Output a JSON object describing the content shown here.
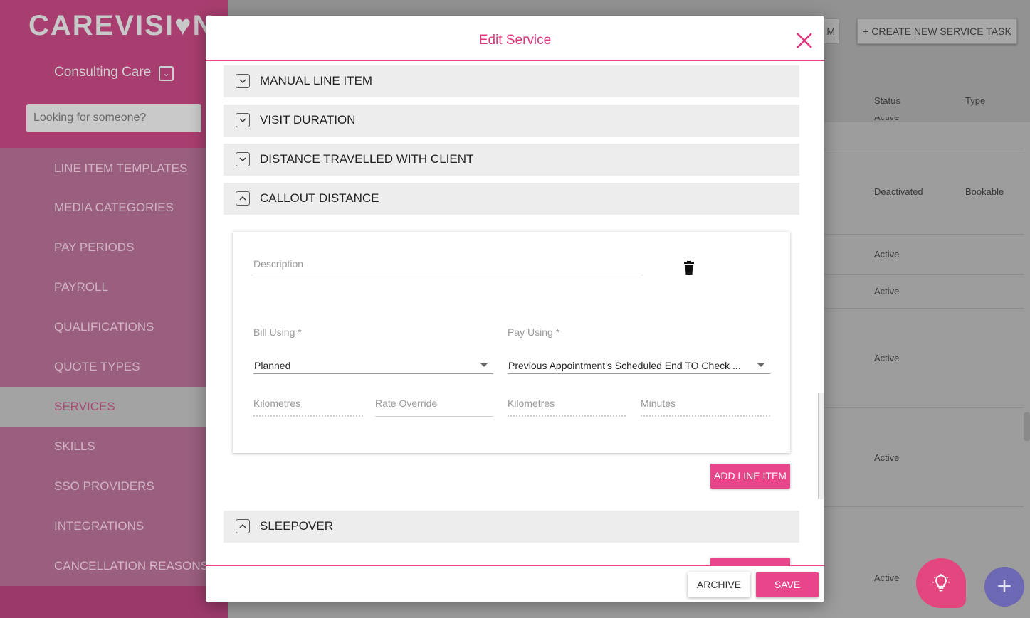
{
  "app": {
    "logo": "CAREVISI♥N",
    "organisation": "Consulting Care",
    "search_placeholder": "Looking for someone?"
  },
  "sidebar": {
    "items": [
      {
        "label": "LINE ITEM TEMPLATES"
      },
      {
        "label": "MEDIA CATEGORIES"
      },
      {
        "label": "PAY PERIODS"
      },
      {
        "label": "PAYROLL"
      },
      {
        "label": "QUALIFICATIONS"
      },
      {
        "label": "QUOTE TYPES"
      },
      {
        "label": "SERVICES",
        "active": true
      },
      {
        "label": "SKILLS"
      },
      {
        "label": "SSO PROVIDERS"
      },
      {
        "label": "INTEGRATIONS"
      },
      {
        "label": "CANCELLATION REASONS"
      }
    ]
  },
  "content": {
    "partial_button": "M",
    "create_button": "+ CREATE NEW SERVICE TASK",
    "columns": {
      "status": "Status",
      "type": "Type"
    },
    "rows": [
      {
        "status": "Active",
        "type": ""
      },
      {
        "status": "Deactivated",
        "type": "Bookable"
      },
      {
        "status": "Active",
        "type": ""
      },
      {
        "status": "Active",
        "type": ""
      },
      {
        "status": "Active",
        "type": ""
      },
      {
        "status": "Active",
        "type": ""
      },
      {
        "status": "Active",
        "type": ""
      }
    ]
  },
  "modal": {
    "title": "Edit Service",
    "sections": {
      "manual_line_item": "MANUAL LINE ITEM",
      "visit_duration": "VISIT DURATION",
      "distance_with_client": "DISTANCE TRAVELLED WITH CLIENT",
      "callout_distance": "CALLOUT DISTANCE",
      "sleepover": "SLEEPOVER"
    },
    "form": {
      "description_placeholder": "Description",
      "bill_using_label": "Bill Using *",
      "bill_using_value": "Planned",
      "pay_using_label": "Pay Using *",
      "pay_using_value": "Previous Appointment's Scheduled End TO Check ...",
      "bill_kilometres_label": "Kilometres",
      "rate_override_label": "Rate Override",
      "pay_kilometres_label": "Kilometres",
      "minutes_label": "Minutes"
    },
    "add_line_item": "ADD LINE ITEM",
    "footer": {
      "archive": "ARCHIVE",
      "save": "SAVE"
    }
  },
  "colors": {
    "accent": "#e8458a",
    "brand": "#a83e6f",
    "fab_purple": "#6c68b4"
  }
}
